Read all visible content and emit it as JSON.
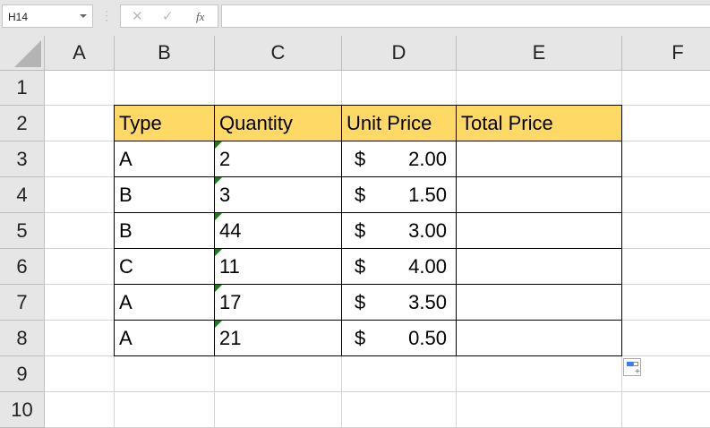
{
  "formula_bar": {
    "name_box": "H14",
    "cancel_icon": "✕",
    "enter_icon": "✓",
    "fx_label": "fx",
    "formula": ""
  },
  "columns": [
    "A",
    "B",
    "C",
    "D",
    "E",
    "F"
  ],
  "rows": [
    "1",
    "2",
    "3",
    "4",
    "5",
    "6",
    "7",
    "8",
    "9",
    "10"
  ],
  "table": {
    "headers": [
      "Type",
      "Quantity",
      "Unit Price",
      "Total Price"
    ],
    "rows": [
      {
        "type": "A",
        "quantity": "2",
        "currency": "$",
        "unit_price": "2.00",
        "total": ""
      },
      {
        "type": "B",
        "quantity": "3",
        "currency": "$",
        "unit_price": "1.50",
        "total": ""
      },
      {
        "type": "B",
        "quantity": "44",
        "currency": "$",
        "unit_price": "3.00",
        "total": ""
      },
      {
        "type": "C",
        "quantity": "11",
        "currency": "$",
        "unit_price": "4.00",
        "total": ""
      },
      {
        "type": "A",
        "quantity": "17",
        "currency": "$",
        "unit_price": "3.50",
        "total": ""
      },
      {
        "type": "A",
        "quantity": "21",
        "currency": "$",
        "unit_price": "0.50",
        "total": ""
      }
    ]
  },
  "colors": {
    "header_fill": "#ffd966",
    "error_triangle": "#1e7b1e"
  }
}
